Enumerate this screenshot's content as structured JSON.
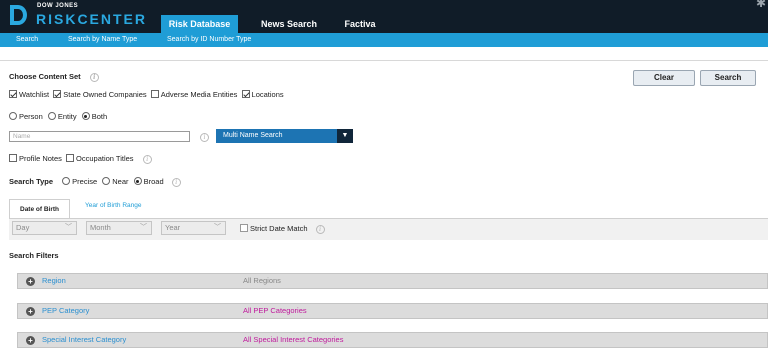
{
  "brand": {
    "top": "DOW JONES",
    "main": "RISKCENTER"
  },
  "nav": {
    "tabs": [
      "Risk Database",
      "News Search",
      "Factiva"
    ],
    "active": 0
  },
  "subnav": {
    "items": [
      "Search",
      "Search by Name Type",
      "Search by ID Number Type"
    ]
  },
  "content_set": {
    "label": "Choose Content Set",
    "options": [
      {
        "label": "Watchlist",
        "checked": true
      },
      {
        "label": "State Owned Companies",
        "checked": true
      },
      {
        "label": "Adverse Media Entities",
        "checked": false
      },
      {
        "label": "Locations",
        "checked": true
      }
    ]
  },
  "buttons": {
    "clear": "Clear",
    "search": "Search"
  },
  "entity_type": {
    "options": [
      "Person",
      "Entity",
      "Both"
    ],
    "selected": "Both"
  },
  "name_field": {
    "placeholder": "Name",
    "value": ""
  },
  "multi_name": {
    "label": "Multi Name Search"
  },
  "extra_options": [
    {
      "label": "Profile Notes",
      "checked": false
    },
    {
      "label": "Occupation Titles",
      "checked": false
    }
  ],
  "search_type": {
    "label": "Search Type",
    "options": [
      "Precise",
      "Near",
      "Broad"
    ],
    "selected": "Broad"
  },
  "date_tabs": {
    "dob": "Date of Birth",
    "yob": "Year of Birth Range"
  },
  "date_selects": {
    "day": "Day",
    "month": "Month",
    "year": "Year"
  },
  "strict_date": {
    "label": "Strict Date Match",
    "checked": false
  },
  "filters": {
    "heading": "Search Filters",
    "rows": [
      {
        "name": "Region",
        "value": "All Regions",
        "value_color": "#888888"
      },
      {
        "name": "PEP Category",
        "value": "All PEP Categories",
        "value_color": "#c0199c"
      },
      {
        "name": "Special Interest Category",
        "value": "All Special Interest Categories",
        "value_color": "#c0199c"
      }
    ]
  },
  "colors": {
    "header_bg": "#101c28",
    "accent": "#1f9dd6",
    "multi_bg": "#1d74b3",
    "link": "#2a8fd0"
  }
}
